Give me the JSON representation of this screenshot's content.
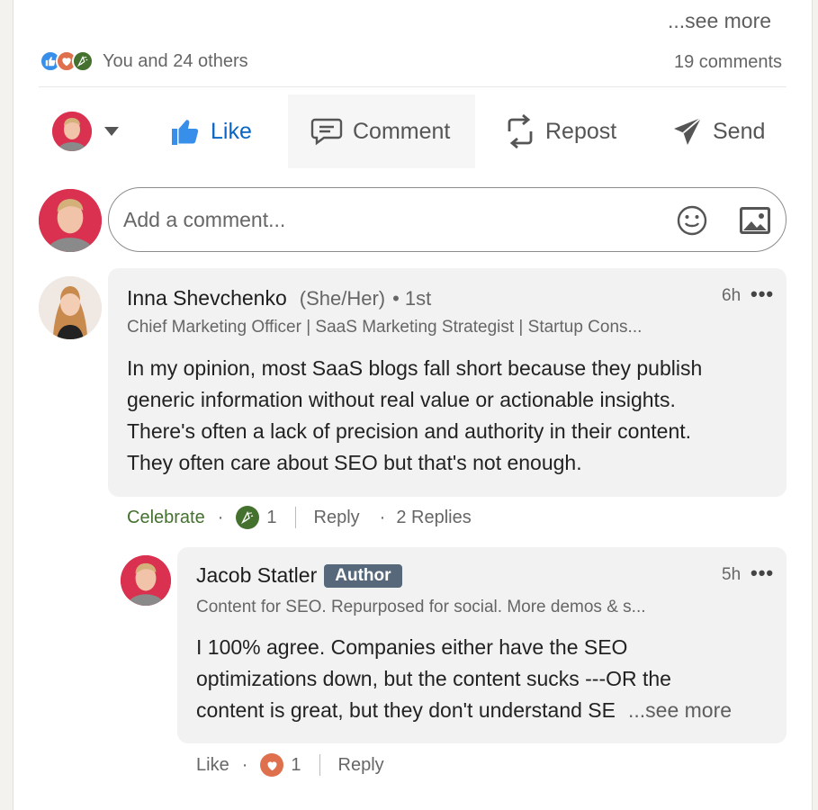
{
  "post": {
    "see_more": "...see more",
    "reactions_text": "You and 24 others",
    "comments_count": "19 comments",
    "reaction_icons": [
      "like-icon",
      "love-icon",
      "celebrate-icon"
    ]
  },
  "actions": {
    "like": "Like",
    "comment": "Comment",
    "repost": "Repost",
    "send": "Send"
  },
  "comment_input": {
    "placeholder": "Add a comment..."
  },
  "comments": [
    {
      "name": "Inna Shevchenko",
      "pronouns": "(She/Her)",
      "degree": "• 1st",
      "headline": "Chief Marketing Officer | SaaS Marketing Strategist | Startup Cons...",
      "time": "6h",
      "more": "•••",
      "text_lines": [
        "In my opinion, most SaaS blogs fall short because they publish",
        "generic information without real value or actionable insights.",
        "There's often a lack of precision and authority in their content.",
        "They often care about SEO but that's not enough."
      ],
      "reaction_label": "Celebrate",
      "reaction_count": "1",
      "reply": "Reply",
      "replies": "2 Replies",
      "dot": "·"
    },
    {
      "name": "Jacob Statler",
      "badge": "Author",
      "headline": "Content for SEO. Repurposed for social. More demos & s...",
      "time": "5h",
      "more": "•••",
      "text_lines": [
        "I 100% agree. Companies either have the SEO",
        "optimizations down, but the content sucks ---OR the",
        "content is great, but they don't understand SE"
      ],
      "see_more": "...see more",
      "reaction_label": "Like",
      "reaction_count": "1",
      "reply": "Reply",
      "dot": "·"
    }
  ],
  "colors": {
    "like_blue": "#0a66c2",
    "celebrate_green": "#44712e",
    "love_orange": "#df704d",
    "author_badge": "#56687a"
  }
}
